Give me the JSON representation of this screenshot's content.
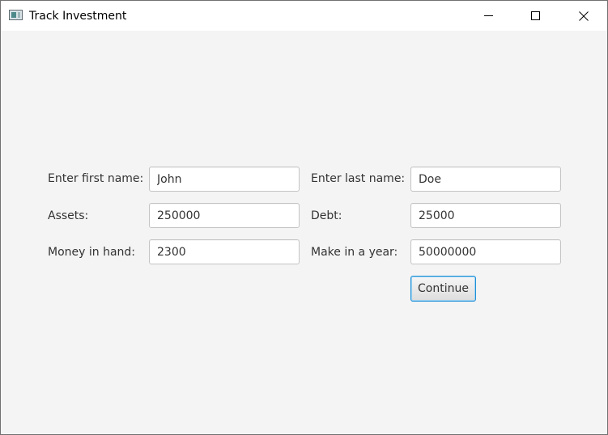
{
  "window": {
    "title": "Track Investment",
    "controls": {
      "minimize": "minimize-icon",
      "maximize": "maximize-icon",
      "close": "close-icon"
    }
  },
  "form": {
    "first_name": {
      "label": "Enter first name:",
      "value": "John"
    },
    "last_name": {
      "label": "Enter last name:",
      "value": "Doe"
    },
    "assets": {
      "label": "Assets:",
      "value": "250000"
    },
    "debt": {
      "label": "Debt:",
      "value": "25000"
    },
    "money_in_hand": {
      "label": "Money in hand:",
      "value": "2300"
    },
    "make_in_year": {
      "label": "Make in a year:",
      "value": "50000000"
    },
    "continue_label": "Continue"
  },
  "colors": {
    "window_bg": "#f4f4f4",
    "titlebar_bg": "#ffffff",
    "focus_border": "#1c8fd6"
  }
}
